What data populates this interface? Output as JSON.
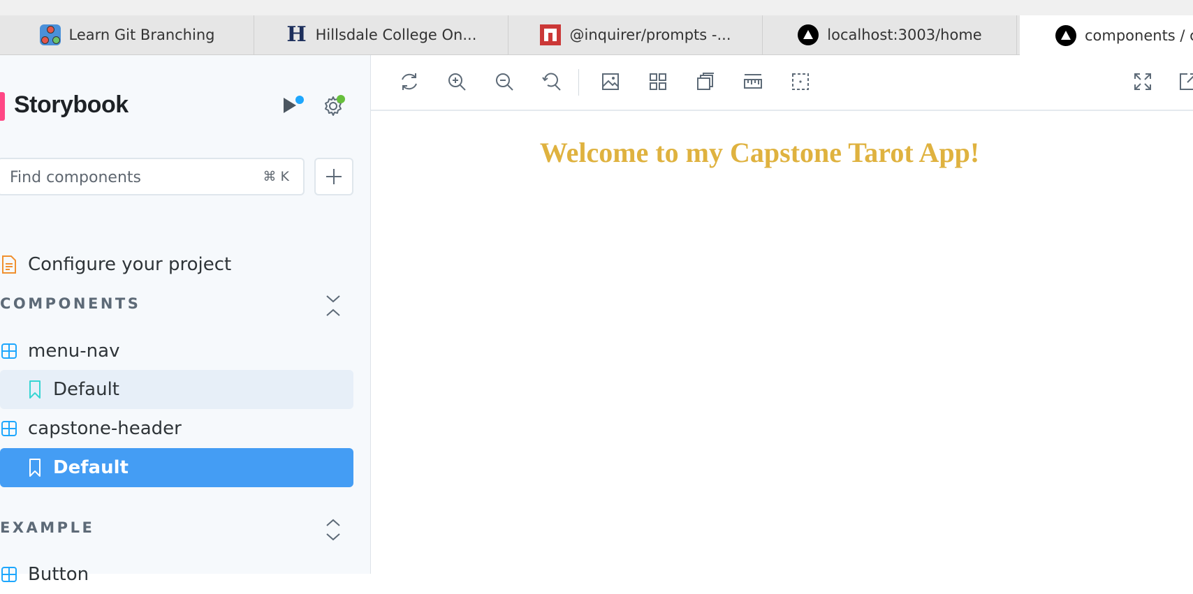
{
  "browser": {
    "tabs": [
      {
        "title": "Learn Git Branching",
        "icon": "git-branching-icon"
      },
      {
        "title": "Hillsdale College On...",
        "icon": "hillsdale-h-icon"
      },
      {
        "title": "@inquirer/prompts -...",
        "icon": "npm-icon"
      },
      {
        "title": "localhost:3003/home",
        "icon": "vercel-triangle-icon"
      },
      {
        "title": "components / c",
        "icon": "vercel-triangle-icon"
      }
    ]
  },
  "sidebar": {
    "brand": "Storybook",
    "search": {
      "placeholder": "Find components",
      "shortcut": "⌘ K"
    },
    "configure": "Configure your project",
    "sections": [
      {
        "title": "COMPONENTS",
        "items": [
          {
            "label": "menu-nav",
            "type": "component"
          },
          {
            "label": "Default",
            "type": "story",
            "selected": "soft"
          },
          {
            "label": "capstone-header",
            "type": "component"
          },
          {
            "label": "Default",
            "type": "story",
            "selected": "active"
          }
        ]
      },
      {
        "title": "EXAMPLE",
        "items": [
          {
            "label": "Button",
            "type": "component"
          }
        ]
      }
    ]
  },
  "toolbar": {
    "left_icons": [
      "reload-icon",
      "zoom-in-icon",
      "zoom-out-icon",
      "zoom-reset-icon",
      "background-icon",
      "grid-icon",
      "viewport-icon",
      "measure-icon",
      "outline-icon"
    ],
    "right_icons": [
      "fullscreen-icon",
      "open-new-tab-icon"
    ]
  },
  "preview": {
    "heading": "Welcome to my Capstone Tarot App!"
  },
  "colors": {
    "storybook_pink": "#ff4785",
    "accent_blue": "#449df4",
    "status_green": "#66bf3c",
    "heading_gold": "#dfb23f"
  }
}
